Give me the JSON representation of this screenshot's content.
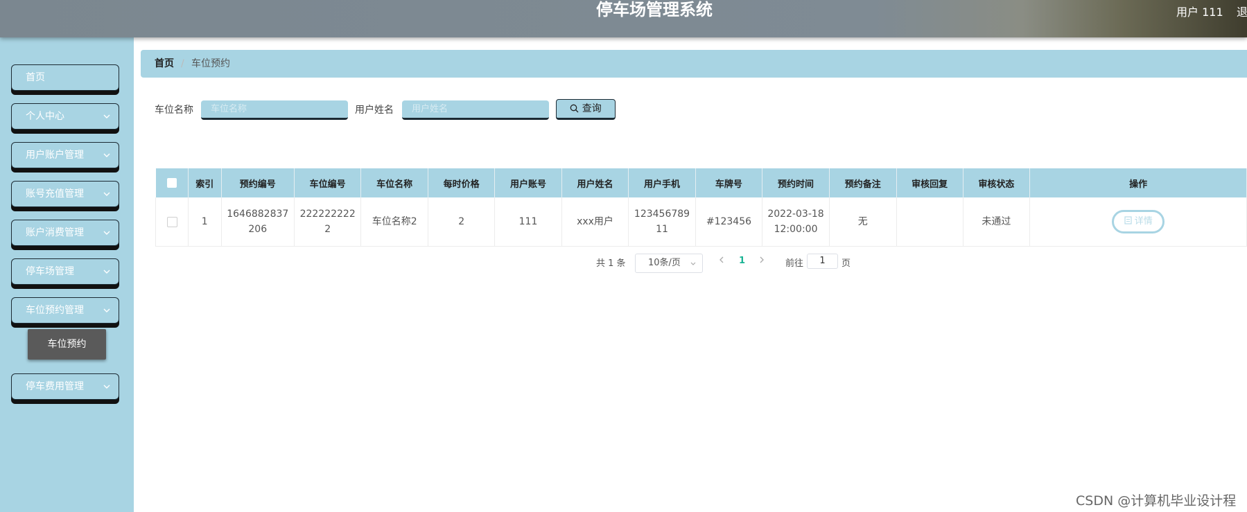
{
  "header": {
    "title": "停车场管理系统",
    "user": "用户 111",
    "logout": "退出"
  },
  "sidebar": {
    "items": [
      {
        "label": "首页",
        "has_chevron": false
      },
      {
        "label": "个人中心",
        "has_chevron": true
      },
      {
        "label": "用户账户管理",
        "has_chevron": true
      },
      {
        "label": "账号充值管理",
        "has_chevron": true
      },
      {
        "label": "账户消费管理",
        "has_chevron": true
      },
      {
        "label": "停车场管理",
        "has_chevron": true
      },
      {
        "label": "车位预约管理",
        "has_chevron": true,
        "expanded": true
      },
      {
        "label": "停车费用管理",
        "has_chevron": true
      }
    ],
    "subitem": "车位预约"
  },
  "breadcrumb": {
    "home": "首页",
    "separator": "/",
    "current": "车位预约"
  },
  "search": {
    "field1_label": "车位名称",
    "field1_placeholder": "车位名称",
    "field2_label": "用户姓名",
    "field2_placeholder": "用户姓名",
    "button": "查询"
  },
  "table": {
    "headers": [
      "索引",
      "预约编号",
      "车位编号",
      "车位名称",
      "每时价格",
      "用户账号",
      "用户姓名",
      "用户手机",
      "车牌号",
      "预约时间",
      "预约备注",
      "审核回复",
      "审核状态",
      "操作"
    ],
    "rows": [
      {
        "index": "1",
        "booking_no": "1646882837206",
        "space_no": "2222222222",
        "space_name": "车位名称2",
        "price": "2",
        "account": "111",
        "user_name": "xxx用户",
        "phone": "12345678911",
        "plate": "#123456",
        "time": "2022-03-18 12:00:00",
        "remark": "无",
        "reply": "",
        "status": "未通过",
        "action": "详情"
      }
    ]
  },
  "pagination": {
    "total": "共 1 条",
    "page_size": "10条/页",
    "current_page": "1",
    "goto_label": "前往",
    "goto_value": "1",
    "page_suffix": "页"
  },
  "watermark": "CSDN @计算机毕业设计程",
  "colors": {
    "accent": "#a8d4e3",
    "submenu": "#5a5a5a",
    "active_page": "#1ab394"
  }
}
